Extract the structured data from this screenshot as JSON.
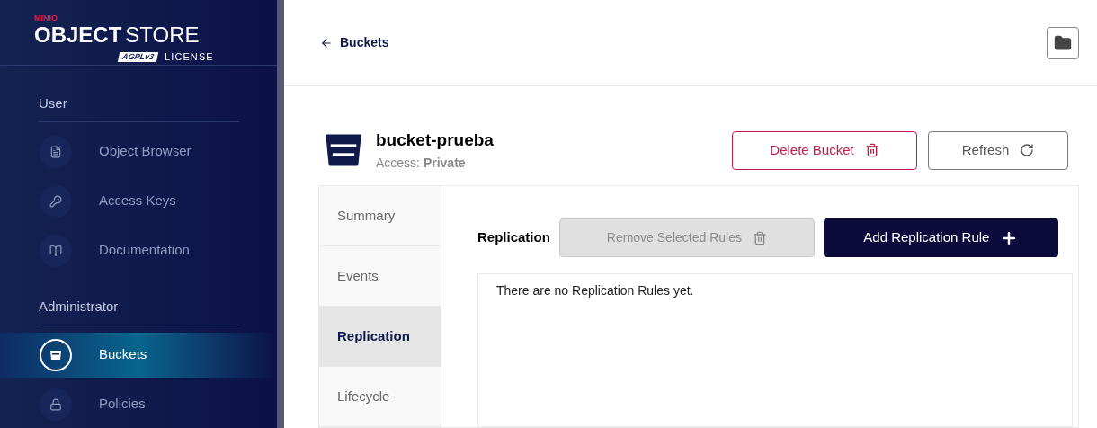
{
  "brand": {
    "maker": "MINIO",
    "product_bold": "OBJECT",
    "product_light": "STORE",
    "license_badge": "AGPLv3",
    "license": "LICENSE"
  },
  "sidebar": {
    "sections": [
      {
        "title": "User",
        "items": [
          {
            "label": "Object Browser",
            "kind": "browser",
            "selected": false
          },
          {
            "label": "Access Keys",
            "kind": "keys",
            "selected": false
          },
          {
            "label": "Documentation",
            "kind": "docs",
            "selected": false
          }
        ]
      },
      {
        "title": "Administrator",
        "items": [
          {
            "label": "Buckets",
            "kind": "bucket",
            "selected": true
          },
          {
            "label": "Policies",
            "kind": "lock",
            "selected": false
          }
        ]
      }
    ]
  },
  "header": {
    "back_link": "Buckets"
  },
  "bucket": {
    "name": "bucket-prueba",
    "access_label": "Access:",
    "access_value": "Private"
  },
  "actions": [
    {
      "label": "Delete Bucket",
      "kind": "danger"
    },
    {
      "label": "Refresh",
      "kind": "plain"
    }
  ],
  "tabs": [
    {
      "label": "Summary",
      "selected": false
    },
    {
      "label": "Events",
      "selected": false
    },
    {
      "label": "Replication",
      "selected": true
    },
    {
      "label": "Lifecycle",
      "selected": false
    }
  ],
  "replication": {
    "title": "Replication",
    "remove_button": {
      "label": "Remove Selected Rules",
      "disabled": true
    },
    "add_button": {
      "label": "Add Replication Rule"
    },
    "empty_message": "There are no Replication Rules yet."
  }
}
